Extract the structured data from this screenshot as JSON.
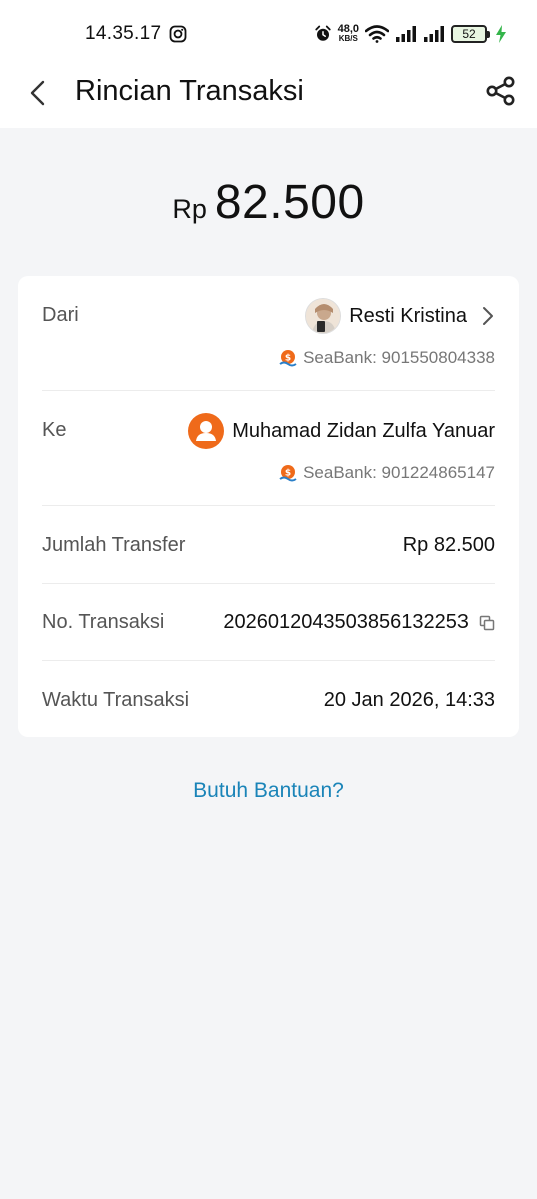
{
  "status_bar": {
    "time": "14.35.17",
    "speed_value": "48,0",
    "speed_unit": "KB/S",
    "battery": "52"
  },
  "header": {
    "title": "Rincian Transaksi"
  },
  "amount": {
    "currency": "Rp",
    "value": "82.500"
  },
  "details": {
    "from_label": "Dari",
    "from_name": "Resti Kristina",
    "from_bank": "SeaBank: 901550804338",
    "to_label": "Ke",
    "to_name": "Muhamad Zidan Zulfa Yanuar",
    "to_bank": "SeaBank: 901224865147",
    "amount_label": "Jumlah Transfer",
    "amount_value": "Rp 82.500",
    "txn_no_label": "No. Transaksi",
    "txn_no_value": "202601204350385613225З",
    "txn_time_label": "Waktu Transaksi",
    "txn_time_value": "20 Jan 2026, 14:33"
  },
  "help": {
    "label": "Butuh Bantuan?"
  },
  "colors": {
    "accent_link": "#1a84b8",
    "bank_orange": "#ef6a1a",
    "background": "#f4f5f7"
  }
}
